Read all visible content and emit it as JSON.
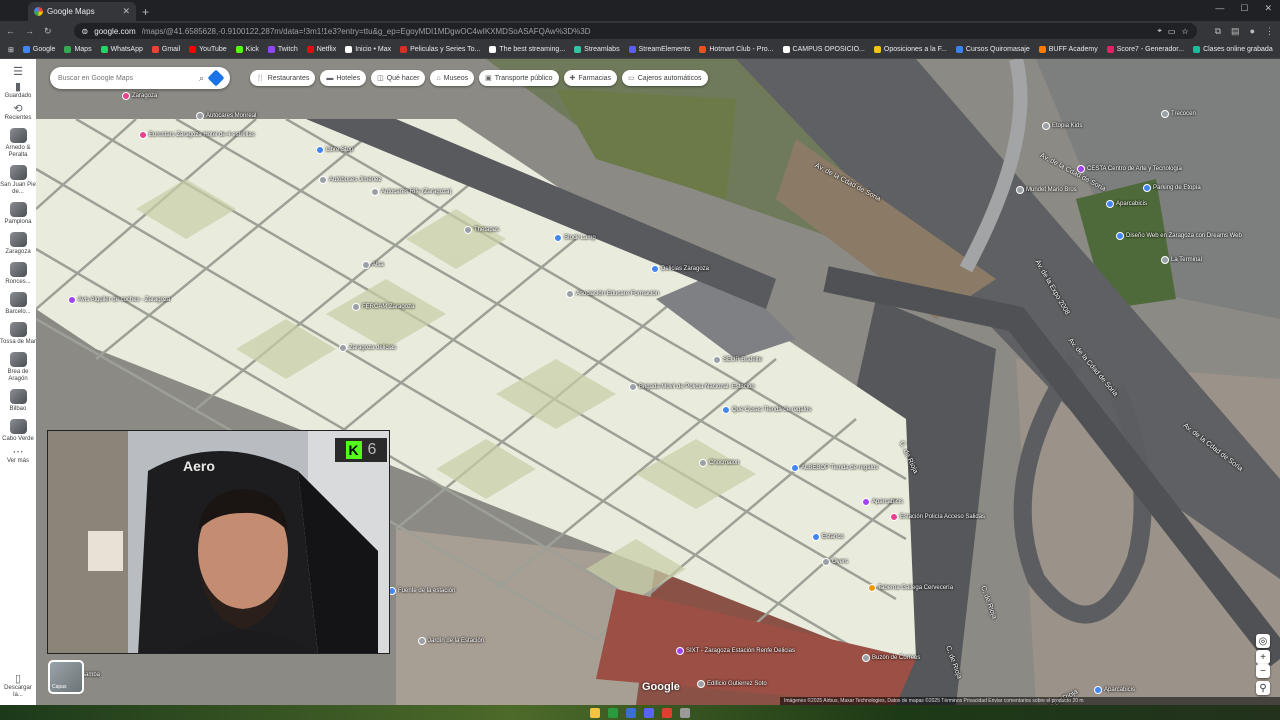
{
  "browser": {
    "tab_title": "Google Maps",
    "url_host": "google.com",
    "url_rest": "/maps/@41.6585628,-0.9100122,287m/data=!3m1!1e3?entry=ttu&g_ep=EgoyMDI1MDgwOC4wIKXMDSoASAFQAw%3D%3D",
    "bookmarks": [
      {
        "label": "Google",
        "color": "#4285f4"
      },
      {
        "label": "Maps",
        "color": "#34a853"
      },
      {
        "label": "WhatsApp",
        "color": "#25d366"
      },
      {
        "label": "Gmail",
        "color": "#ea4335"
      },
      {
        "label": "YouTube",
        "color": "#ff0000"
      },
      {
        "label": "Kick",
        "color": "#53fc18"
      },
      {
        "label": "Twitch",
        "color": "#9146ff"
      },
      {
        "label": "Netflix",
        "color": "#e50914"
      },
      {
        "label": "Inicio • Max",
        "color": "#ffffff"
      },
      {
        "label": "Peliculas y Series To...",
        "color": "#d93025"
      },
      {
        "label": "The best streaming...",
        "color": "#ffffff"
      },
      {
        "label": "Streamlabs",
        "color": "#31c3a2"
      },
      {
        "label": "StreamElements",
        "color": "#5c5cff"
      },
      {
        "label": "Hotmart Club - Pro...",
        "color": "#f04e23"
      },
      {
        "label": "CAMPUS OPOSICIO...",
        "color": "#ffffff"
      },
      {
        "label": "Oposiciones a la F...",
        "color": "#f1c40f"
      },
      {
        "label": "Cursos Quiromasaje",
        "color": "#3b82f6"
      },
      {
        "label": "BUFF Academy",
        "color": "#ff7a00"
      },
      {
        "label": "Score7 - Generador...",
        "color": "#e91e63"
      },
      {
        "label": "Clases online grabada",
        "color": "#1abc9c"
      }
    ],
    "all_bookmarks": "Todos los marcadores"
  },
  "rail": {
    "menu_icon": "menu-icon",
    "items": [
      {
        "label": "Guardado",
        "icon": "bookmark-icon"
      },
      {
        "label": "Recientes",
        "icon": "history-icon"
      }
    ],
    "recents": [
      "Arnedo & Peralta",
      "San Juan Pie de...",
      "Pamplona",
      "Zaragoza",
      "Ronces...",
      "Barcelo...",
      "Tossa de Mar",
      "Brea de Aragón",
      "Bilbao",
      "Cabo Verde"
    ],
    "more": "Ver más",
    "download": "Descargar la..."
  },
  "search": {
    "placeholder": "Buscar en Google Maps"
  },
  "chips": [
    {
      "label": "Restaurantes",
      "icon": "fork-icon"
    },
    {
      "label": "Hoteles",
      "icon": "bed-icon"
    },
    {
      "label": "Qué hacer",
      "icon": "camera-icon"
    },
    {
      "label": "Museos",
      "icon": "museum-icon"
    },
    {
      "label": "Transporte público",
      "icon": "bus-icon"
    },
    {
      "label": "Farmacias",
      "icon": "pharmacy-icon"
    },
    {
      "label": "Cajeros automáticos",
      "icon": "atm-icon"
    }
  ],
  "places": [
    {
      "name": "Zaragoza",
      "color": "#e8418f"
    },
    {
      "name": "Autocares Monreal",
      "color": "#9aa0a6"
    },
    {
      "name": "Eurostars Zaragoza Hotel de 4 estrellas",
      "color": "#e8418f"
    },
    {
      "name": "Libre Stop",
      "color": "#4285f4"
    },
    {
      "name": "Autobuses Jiménez",
      "color": "#9aa0a6"
    },
    {
      "name": "Autocares Rife (Zaragoza)",
      "color": "#9aa0a6"
    },
    {
      "name": "Thetapas",
      "color": "#9aa0a6"
    },
    {
      "name": "Alsa",
      "color": "#9aa0a6"
    },
    {
      "name": "Avis Alquiler de coches - Zaragoza",
      "color": "#a142f4"
    },
    {
      "name": "FERCAM Zaragoza",
      "color": "#9aa0a6"
    },
    {
      "name": "Zaragoza delicias",
      "color": "#9aa0a6"
    },
    {
      "name": "Asociación Educare Formación",
      "color": "#9aa0a6"
    },
    {
      "name": "Delicias Zaragoza",
      "color": "#4285f4"
    },
    {
      "name": "Stock Lamp",
      "color": "#4285f4"
    },
    {
      "name": "SEUR Brafelte",
      "color": "#9aa0a6"
    },
    {
      "name": "Brigada Móvil de Policía Nacional. Estación",
      "color": "#9aa0a6"
    },
    {
      "name": "Qué Cosas Tienda de regalos",
      "color": "#4285f4"
    },
    {
      "name": "Chocmalon",
      "color": "#9aa0a6"
    },
    {
      "name": "ALBEBOP Tienda de regalos",
      "color": "#4285f4"
    },
    {
      "name": "Estanco",
      "color": "#4285f4"
    },
    {
      "name": "Overs",
      "color": "#9aa0a6"
    },
    {
      "name": "Taberna Gallega Cervecería",
      "color": "#f29900"
    },
    {
      "name": "Fuente de la estación",
      "color": "#4285f4"
    },
    {
      "name": "Jardín de la Estación",
      "color": "#9aa0a6"
    },
    {
      "name": "SIXT - Zaragoza Estación Renfe Delicias",
      "color": "#a142f4"
    },
    {
      "name": "Edificio Gutierrez Soto",
      "color": "#9aa0a6"
    },
    {
      "name": "Buzón de Correos",
      "color": "#9aa0a6"
    },
    {
      "name": "Aparcabicis",
      "color": "#a142f4"
    },
    {
      "name": "Estación Policía Acceso Salidas",
      "color": "#e8418f"
    },
    {
      "name": "Etopia Kids",
      "color": "#9aa0a6"
    },
    {
      "name": "Trecocen",
      "color": "#9aa0a6"
    },
    {
      "name": "CESTA Centro de Arte y Tecnología",
      "color": "#a142f4"
    },
    {
      "name": "Mundet Mario Bros",
      "color": "#9aa0a6"
    },
    {
      "name": "Parking de Etopía",
      "color": "#4285f4"
    },
    {
      "name": "Aparcabicis",
      "color": "#4285f4"
    },
    {
      "name": "Diseño Web en Zaragoza con Dreams Web",
      "color": "#4285f4"
    },
    {
      "name": "La Terminal",
      "color": "#9aa0a6"
    },
    {
      "name": "Aparcabicis",
      "color": "#4285f4"
    },
    {
      "name": "Samba",
      "color": "#9aa0a6"
    }
  ],
  "roads": [
    "Av. de la Cdad de Soria",
    "Av. de la Cdad de Soria",
    "Av. de la Expo 2008",
    "Av. de la Cdad de Soria",
    "Av. de la Cdad de Soria",
    "C. de Rioja",
    "C. de Rioja",
    "C. de Rioja",
    "C. de La Rioja"
  ],
  "cam": {
    "badge_count": "6"
  },
  "layers_label": "Capas",
  "google_logo": "Google",
  "attribution": "Imágenes ©2025 Airbus, Maxar Technologies, Datos de mapas ©2025   Términos   Privacidad   Enviar comentarios sobre el producto   20 m"
}
